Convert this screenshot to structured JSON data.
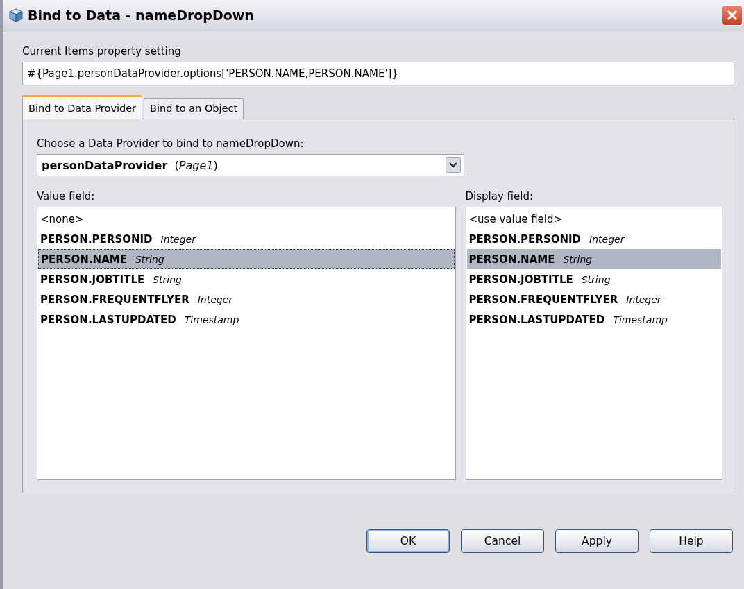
{
  "window": {
    "title": "Bind to Data - nameDropDown"
  },
  "property": {
    "label": "Current Items property setting",
    "value": "#{Page1.personDataProvider.options['PERSON.NAME,PERSON.NAME']}"
  },
  "tabs": [
    {
      "label": "Bind to Data Provider",
      "selected": true
    },
    {
      "label": "Bind to an Object",
      "selected": false
    }
  ],
  "provider": {
    "label": "Choose a Data Provider to bind to nameDropDown:",
    "value": "**personDataProvider**  (*Page1*)"
  },
  "value_list": {
    "label": "Value field:",
    "items": [
      {
        "kind": "none",
        "name": "<none>",
        "selected": false
      },
      {
        "kind": "field",
        "name": "PERSON.PERSONID",
        "type": "Integer",
        "selected": false
      },
      {
        "kind": "field",
        "name": "PERSON.NAME",
        "type": "String",
        "selected": true
      },
      {
        "kind": "field",
        "name": "PERSON.JOBTITLE",
        "type": "String",
        "selected": false
      },
      {
        "kind": "field",
        "name": "PERSON.FREQUENTFLYER",
        "type": "Integer",
        "selected": false
      },
      {
        "kind": "field",
        "name": "PERSON.LASTUPDATED",
        "type": "Timestamp",
        "selected": false
      }
    ]
  },
  "display_list": {
    "label": "Display field:",
    "items": [
      {
        "kind": "none",
        "name": "<use value field>",
        "selected": false
      },
      {
        "kind": "field",
        "name": "PERSON.PERSONID",
        "type": "Integer",
        "selected": false
      },
      {
        "kind": "field",
        "name": "PERSON.NAME",
        "type": "String",
        "selected": true
      },
      {
        "kind": "field",
        "name": "PERSON.JOBTITLE",
        "type": "String",
        "selected": false
      },
      {
        "kind": "field",
        "name": "PERSON.FREQUENTFLYER",
        "type": "Integer",
        "selected": false
      },
      {
        "kind": "field",
        "name": "PERSON.LASTUPDATED",
        "type": "Timestamp",
        "selected": false
      }
    ]
  },
  "buttons": [
    {
      "label": "OK",
      "selected": true
    },
    {
      "label": "Cancel",
      "selected": false
    },
    {
      "label": "Apply",
      "selected": false
    },
    {
      "label": "Help",
      "selected": false
    }
  ]
}
